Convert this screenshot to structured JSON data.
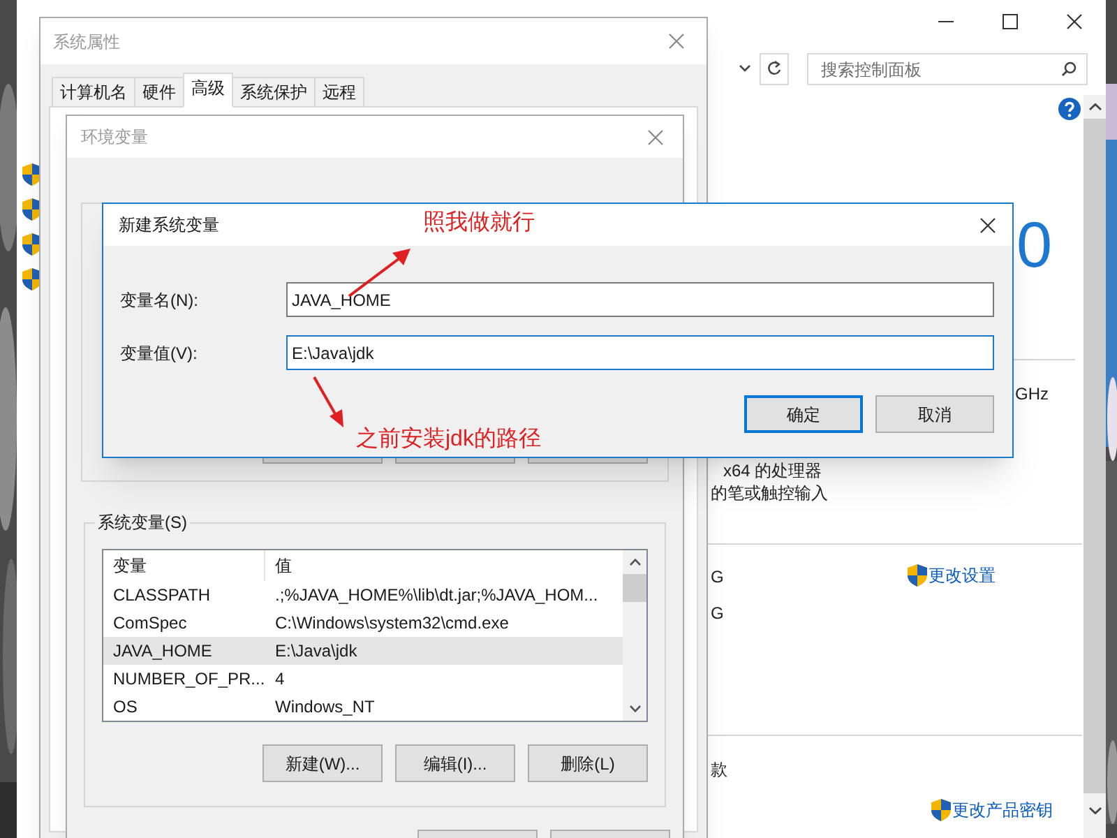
{
  "control_panel": {
    "search": {
      "placeholder": "搜索控制面板"
    },
    "fragments": [
      {
        "kind": "big",
        "text": "0"
      },
      {
        "kind": "plain",
        "text": "GHz"
      },
      {
        "kind": "plain",
        "text": "x64 的处理器"
      },
      {
        "kind": "plain",
        "text": "的笔或触控输入"
      },
      {
        "kind": "plain",
        "text": "G"
      },
      {
        "kind": "plain",
        "text": "G"
      },
      {
        "kind": "plain",
        "text": "款"
      }
    ],
    "links": [
      "更改设置",
      "更改产品密钥"
    ]
  },
  "system_properties": {
    "title": "系统属性",
    "tabs": [
      {
        "label": "计算机名",
        "selected": false
      },
      {
        "label": "硬件",
        "selected": false
      },
      {
        "label": "高级",
        "selected": true
      },
      {
        "label": "系统保护",
        "selected": false
      },
      {
        "label": "远程",
        "selected": false
      }
    ]
  },
  "environment_variables": {
    "title": "环境变量",
    "system_variables": {
      "label": "系统变量(S)",
      "columns": [
        "变量",
        "值"
      ],
      "rows": [
        {
          "name": "CLASSPATH",
          "value": ".;%JAVA_HOME%\\lib\\dt.jar;%JAVA_HOM...",
          "selected": false
        },
        {
          "name": "ComSpec",
          "value": "C:\\Windows\\system32\\cmd.exe",
          "selected": false
        },
        {
          "name": "JAVA_HOME",
          "value": "E:\\Java\\jdk",
          "selected": true
        },
        {
          "name": "NUMBER_OF_PR...",
          "value": "4",
          "selected": false
        },
        {
          "name": "OS",
          "value": "Windows_NT",
          "selected": false
        }
      ]
    },
    "buttons": [
      "新建(W)...",
      "编辑(I)...",
      "删除(L)"
    ]
  },
  "new_variable_dialog": {
    "title": "新建系统变量",
    "fields": [
      {
        "label": "变量名(N):",
        "value": "JAVA_HOME",
        "focused": false
      },
      {
        "label": "变量值(V):",
        "value": "E:\\Java\\jdk",
        "focused": true
      }
    ],
    "buttons": [
      {
        "label": "确定",
        "default": true
      },
      {
        "label": "取消",
        "default": false
      }
    ]
  },
  "annotations": [
    "照我做就行",
    "之前安装jdk的路径"
  ]
}
